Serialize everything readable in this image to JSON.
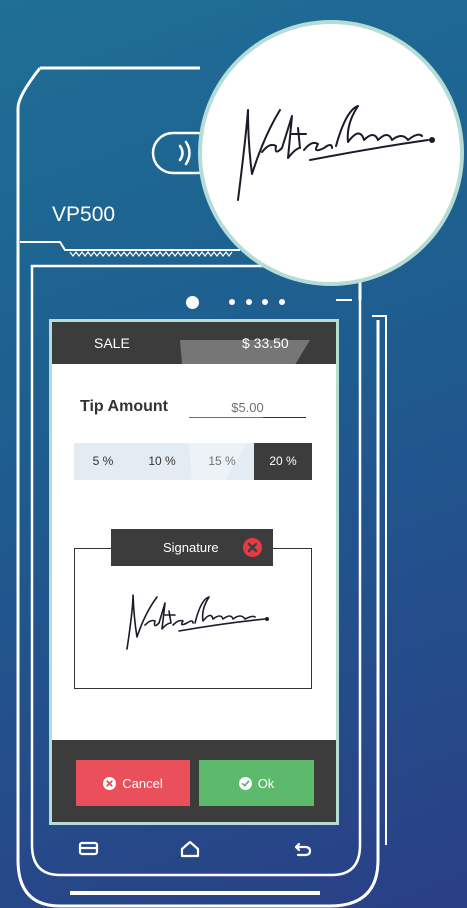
{
  "device": {
    "brand": "VP500"
  },
  "transaction": {
    "type_label": "SALE",
    "amount": "$ 33.50"
  },
  "tip": {
    "label": "Tip Amount",
    "value": "$5.00",
    "options": [
      "5 %",
      "10 %",
      "15 %",
      "20 %"
    ],
    "selected_index": 3
  },
  "signature": {
    "title": "Signature"
  },
  "actions": {
    "cancel_label": "Cancel",
    "ok_label": "Ok"
  },
  "colors": {
    "accent_teal": "#b5ddd6",
    "cancel": "#e9505c",
    "ok": "#5db96b",
    "dark_bar": "#3c3c3c",
    "close_red": "#e83a45"
  }
}
